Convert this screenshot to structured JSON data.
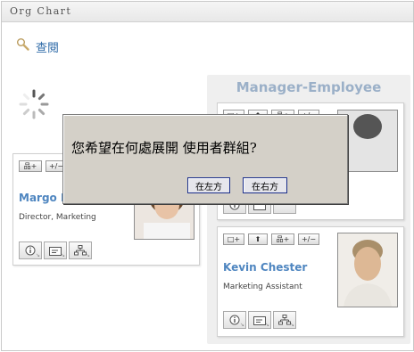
{
  "window": {
    "title": "Org Chart"
  },
  "search": {
    "label": "查閱"
  },
  "manager_panel": {
    "title": "Manager-Employee"
  },
  "toolbar": {
    "collapse": "□+",
    "up": "⬆",
    "expand_group": "品+",
    "add_remove": "+/−"
  },
  "cards": {
    "margo": {
      "name": "Margo M",
      "title": "Director, Marketing"
    },
    "kevin": {
      "name": "Kevin Chester",
      "title": "Marketing Assistant"
    }
  },
  "dialog": {
    "message": "您希望在何處展開  使用者群組?",
    "left_button": "在左方",
    "right_button": "在右方"
  },
  "colors": {
    "link": "#2f6ba8",
    "name": "#4f86c0",
    "panel_title": "#9bb0c8",
    "dialog_bg": "#d4d0c8"
  }
}
